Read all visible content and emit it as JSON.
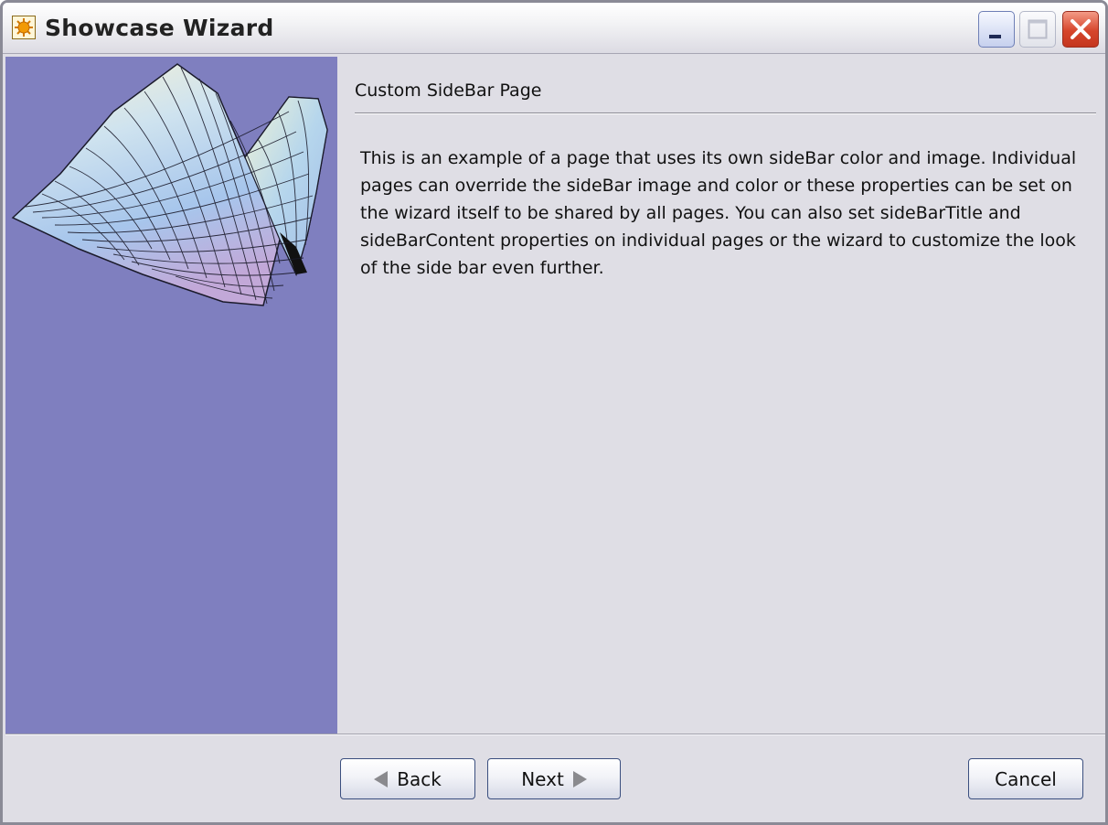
{
  "window": {
    "title": "Showcase Wizard",
    "app_icon": "sun-gear-icon",
    "controls": [
      "minimize-icon",
      "maximize-icon",
      "close-icon"
    ]
  },
  "sidebar": {
    "background_color": "#7f7fbf",
    "image": "3d-surface-plot-image"
  },
  "page": {
    "heading": "Custom SideBar Page",
    "description": "This is an example of a page that uses its own sideBar color and image. Individual pages can override the sideBar image and color or these properties can be set on the wizard itself to be shared by all pages. You can also set sideBarTitle and sideBarContent properties on individual pages or the wizard to customize the look of the side bar even further."
  },
  "buttons": {
    "back": "Back",
    "next": "Next",
    "cancel": "Cancel"
  }
}
